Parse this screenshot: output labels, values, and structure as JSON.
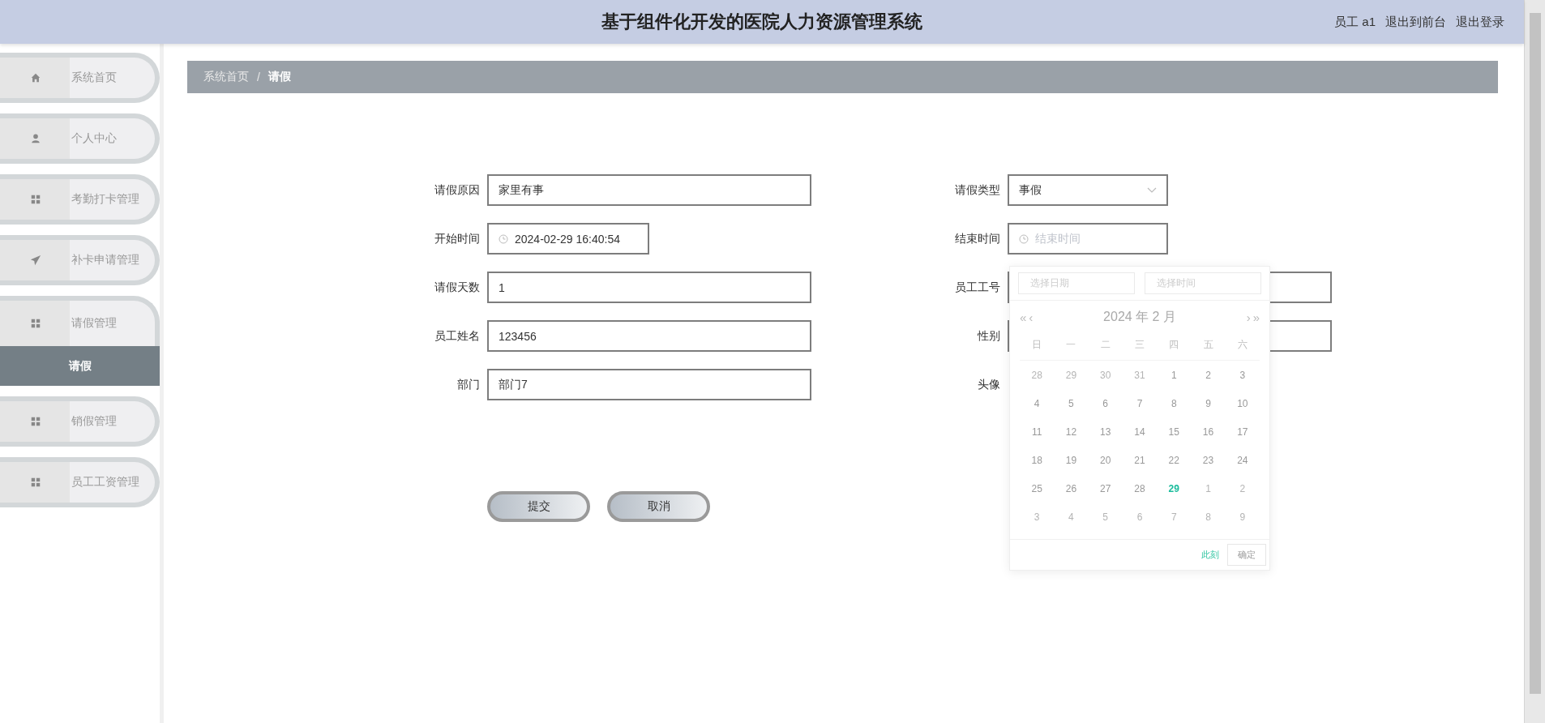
{
  "header": {
    "title": "基于组件化开发的医院人力资源管理系统",
    "user": "员工 a1",
    "links": [
      "退出到前台",
      "退出登录"
    ]
  },
  "sidebar": {
    "items": [
      {
        "label": "系统首页",
        "expanded": false
      },
      {
        "label": "个人中心",
        "expanded": false
      },
      {
        "label": "考勤打卡管理",
        "expanded": false
      },
      {
        "label": "补卡申请管理",
        "expanded": false
      },
      {
        "label": "请假管理",
        "expanded": true,
        "children": [
          {
            "label": "请假",
            "selected": true
          }
        ]
      },
      {
        "label": "销假管理",
        "expanded": false
      },
      {
        "label": "员工工资管理",
        "expanded": false
      }
    ]
  },
  "breadcrumb": [
    "系统首页",
    "/",
    "请假"
  ],
  "form": {
    "left_fields": [
      {
        "kind": "text",
        "label": "请假原因",
        "value": "家里有事"
      },
      {
        "kind": "datetime",
        "label": "开始时间",
        "value": "2024-02-29 16:40:54"
      },
      {
        "kind": "text",
        "label": "请假天数",
        "value": "1"
      },
      {
        "kind": "text",
        "label": "员工姓名",
        "value": "123456"
      },
      {
        "kind": "text",
        "label": "部门",
        "value": "部门7"
      }
    ],
    "right_fields": [
      {
        "kind": "select",
        "label": "请假类型",
        "value": "事假"
      },
      {
        "kind": "datetime",
        "label": "结束时间",
        "placeholder": "结束时间"
      },
      {
        "kind": "text",
        "label": "员工工号"
      },
      {
        "kind": "text",
        "label": "性别"
      },
      {
        "kind": "upload",
        "label": "头像"
      }
    ],
    "buttons": [
      "提交",
      "取消"
    ]
  },
  "date_picker": {
    "date_placeholder": "选择日期",
    "time_placeholder": "选择时间",
    "month_title": "2024 年  2 月",
    "prev_year": "«",
    "prev_month": "‹",
    "next_month": "›",
    "next_year": "»",
    "weekdays": [
      "日",
      "一",
      "二",
      "三",
      "四",
      "五",
      "六"
    ],
    "weeks": [
      [
        {
          "day": "28",
          "kind": "other"
        },
        {
          "day": "29",
          "kind": "other"
        },
        {
          "day": "30",
          "kind": "other"
        },
        {
          "day": "31",
          "kind": "other"
        },
        {
          "day": "1",
          "kind": "current"
        },
        {
          "day": "2",
          "kind": "current"
        },
        {
          "day": "3",
          "kind": "current"
        }
      ],
      [
        {
          "day": "4",
          "kind": "current"
        },
        {
          "day": "5",
          "kind": "current"
        },
        {
          "day": "6",
          "kind": "current"
        },
        {
          "day": "7",
          "kind": "current"
        },
        {
          "day": "8",
          "kind": "current"
        },
        {
          "day": "9",
          "kind": "current"
        },
        {
          "day": "10",
          "kind": "current"
        }
      ],
      [
        {
          "day": "11",
          "kind": "current"
        },
        {
          "day": "12",
          "kind": "current"
        },
        {
          "day": "13",
          "kind": "current"
        },
        {
          "day": "14",
          "kind": "current"
        },
        {
          "day": "15",
          "kind": "current"
        },
        {
          "day": "16",
          "kind": "current"
        },
        {
          "day": "17",
          "kind": "current"
        }
      ],
      [
        {
          "day": "18",
          "kind": "current"
        },
        {
          "day": "19",
          "kind": "current"
        },
        {
          "day": "20",
          "kind": "current"
        },
        {
          "day": "21",
          "kind": "current"
        },
        {
          "day": "22",
          "kind": "current"
        },
        {
          "day": "23",
          "kind": "current"
        },
        {
          "day": "24",
          "kind": "current"
        }
      ],
      [
        {
          "day": "25",
          "kind": "current"
        },
        {
          "day": "26",
          "kind": "current"
        },
        {
          "day": "27",
          "kind": "current"
        },
        {
          "day": "28",
          "kind": "current"
        },
        {
          "day": "29",
          "kind": "today"
        },
        {
          "day": "1",
          "kind": "other"
        },
        {
          "day": "2",
          "kind": "other"
        }
      ],
      [
        {
          "day": "3",
          "kind": "other"
        },
        {
          "day": "4",
          "kind": "other"
        },
        {
          "day": "5",
          "kind": "other"
        },
        {
          "day": "6",
          "kind": "other"
        },
        {
          "day": "7",
          "kind": "other"
        },
        {
          "day": "8",
          "kind": "other"
        },
        {
          "day": "9",
          "kind": "other"
        }
      ]
    ],
    "now_link": "此刻",
    "confirm": "确定"
  }
}
